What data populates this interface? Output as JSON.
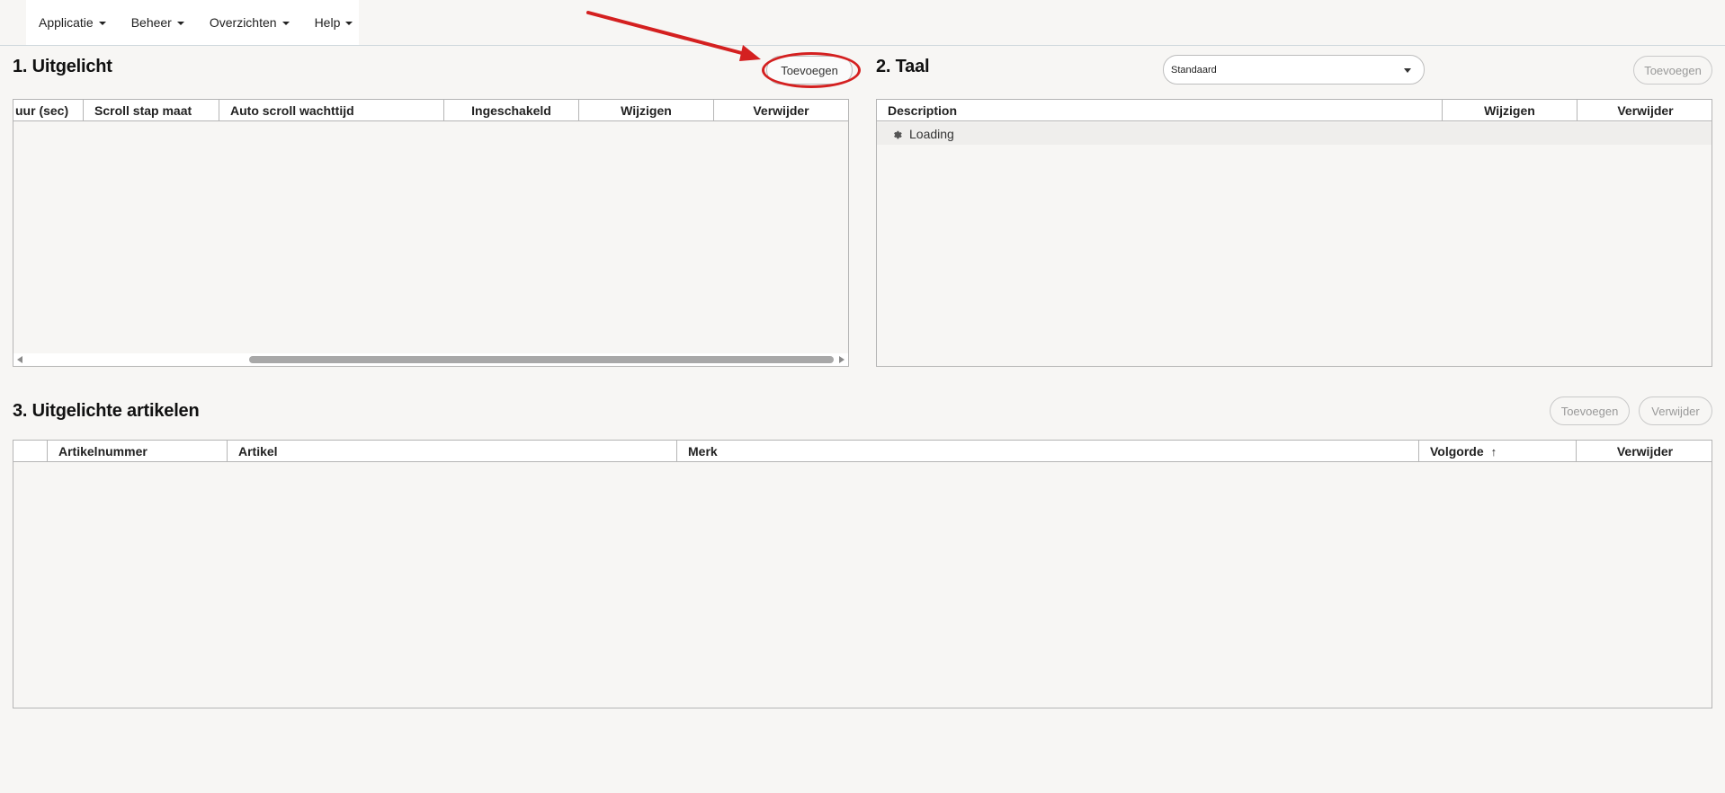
{
  "nav": {
    "items": [
      {
        "label": "Applicatie"
      },
      {
        "label": "Beheer"
      },
      {
        "label": "Overzichten"
      },
      {
        "label": "Help"
      }
    ]
  },
  "section1": {
    "title": "1. Uitgelicht",
    "add_label": "Toevoegen",
    "columns": [
      "uur (sec)",
      "Scroll stap maat",
      "Auto scroll wachttijd",
      "Ingeschakeld",
      "Wijzigen",
      "Verwijder"
    ]
  },
  "section2": {
    "title": "2. Taal",
    "language_select": "Standaard",
    "add_label": "Toevoegen",
    "columns": [
      "Description",
      "Wijzigen",
      "Verwijder"
    ],
    "loading_text": "Loading"
  },
  "section3": {
    "title": "3. Uitgelichte artikelen",
    "add_label": "Toevoegen",
    "delete_label": "Verwijder",
    "columns": [
      "",
      "Artikelnummer",
      "Artikel",
      "Merk",
      "Volgorde",
      "Verwijder"
    ],
    "sort_indicator": "↑"
  },
  "colors": {
    "annotation": "#d42020",
    "background": "#f7f6f4"
  }
}
